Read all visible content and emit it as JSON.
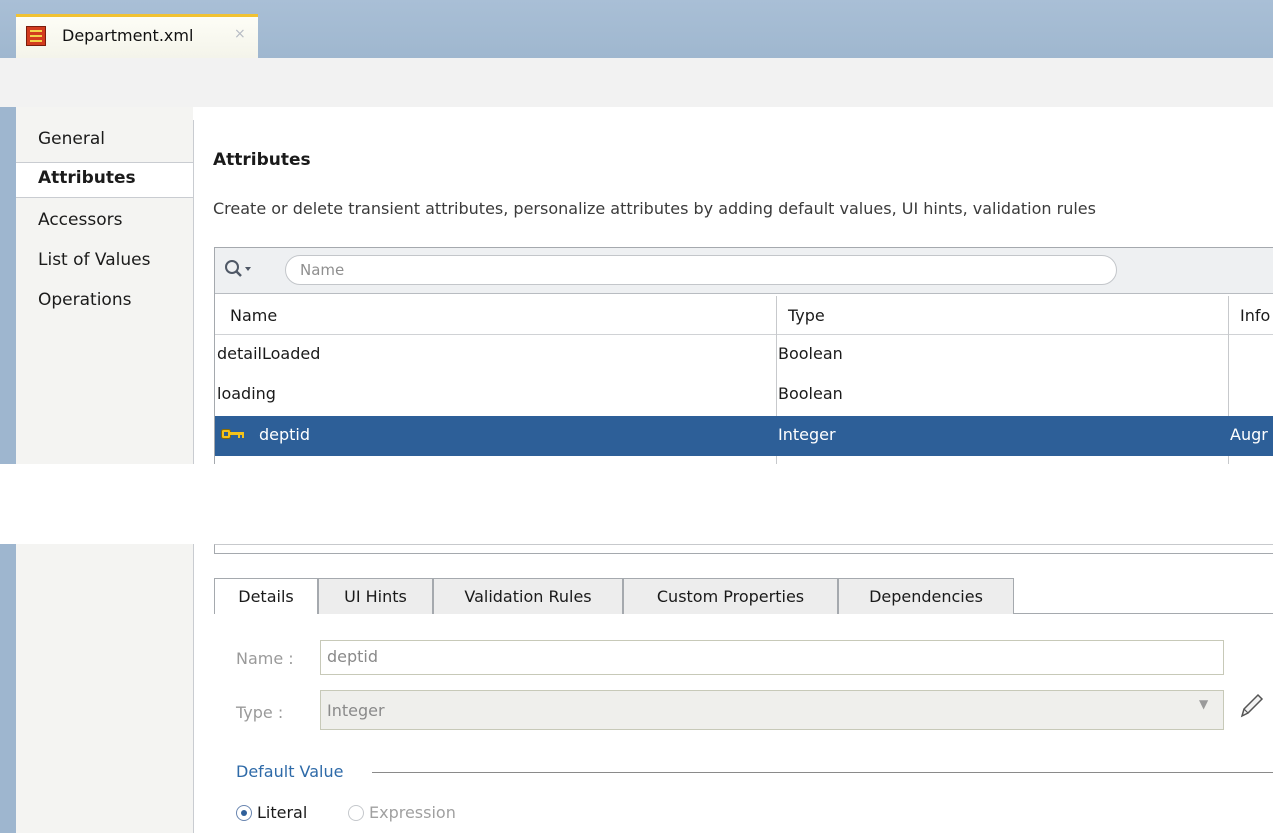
{
  "window": {
    "editor_tab_title": "Department.xml",
    "close_glyph": "×"
  },
  "nav": {
    "items": [
      "General",
      "Attributes",
      "Accessors",
      "List of Values",
      "Operations"
    ],
    "selected": "Attributes"
  },
  "attributes": {
    "heading": "Attributes",
    "description": "Create or delete transient attributes, personalize attributes by adding default values, UI hints, validation rules",
    "search": {
      "placeholder": "Name",
      "icon": "search-icon"
    },
    "columns": [
      "Name",
      "Type",
      "Info"
    ],
    "columns_visible": [
      "Name",
      "Type",
      "Info"
    ],
    "rows": [
      {
        "name": "detailLoaded",
        "type": "Boolean",
        "info": ""
      },
      {
        "name": "loading",
        "type": "Boolean",
        "info": ""
      },
      {
        "name": "deptid",
        "type": "Integer",
        "info": "Augr",
        "selected": true,
        "icon": "key-icon"
      }
    ]
  },
  "detail_tabs": {
    "tabs": [
      "Details",
      "UI Hints",
      "Validation Rules",
      "Custom Properties",
      "Dependencies"
    ],
    "active": "Details"
  },
  "details": {
    "name_label": "Name :",
    "name_value": "deptid",
    "type_label": "Type :",
    "type_value": "Integer",
    "default_value_section": "Default Value",
    "radio_literal": "Literal",
    "radio_expression": "Expression",
    "selected_radio": "Literal"
  },
  "colors": {
    "selection": "#2d5f98",
    "section_title": "#2e6aa8",
    "tab_accent": "#f1c232"
  }
}
